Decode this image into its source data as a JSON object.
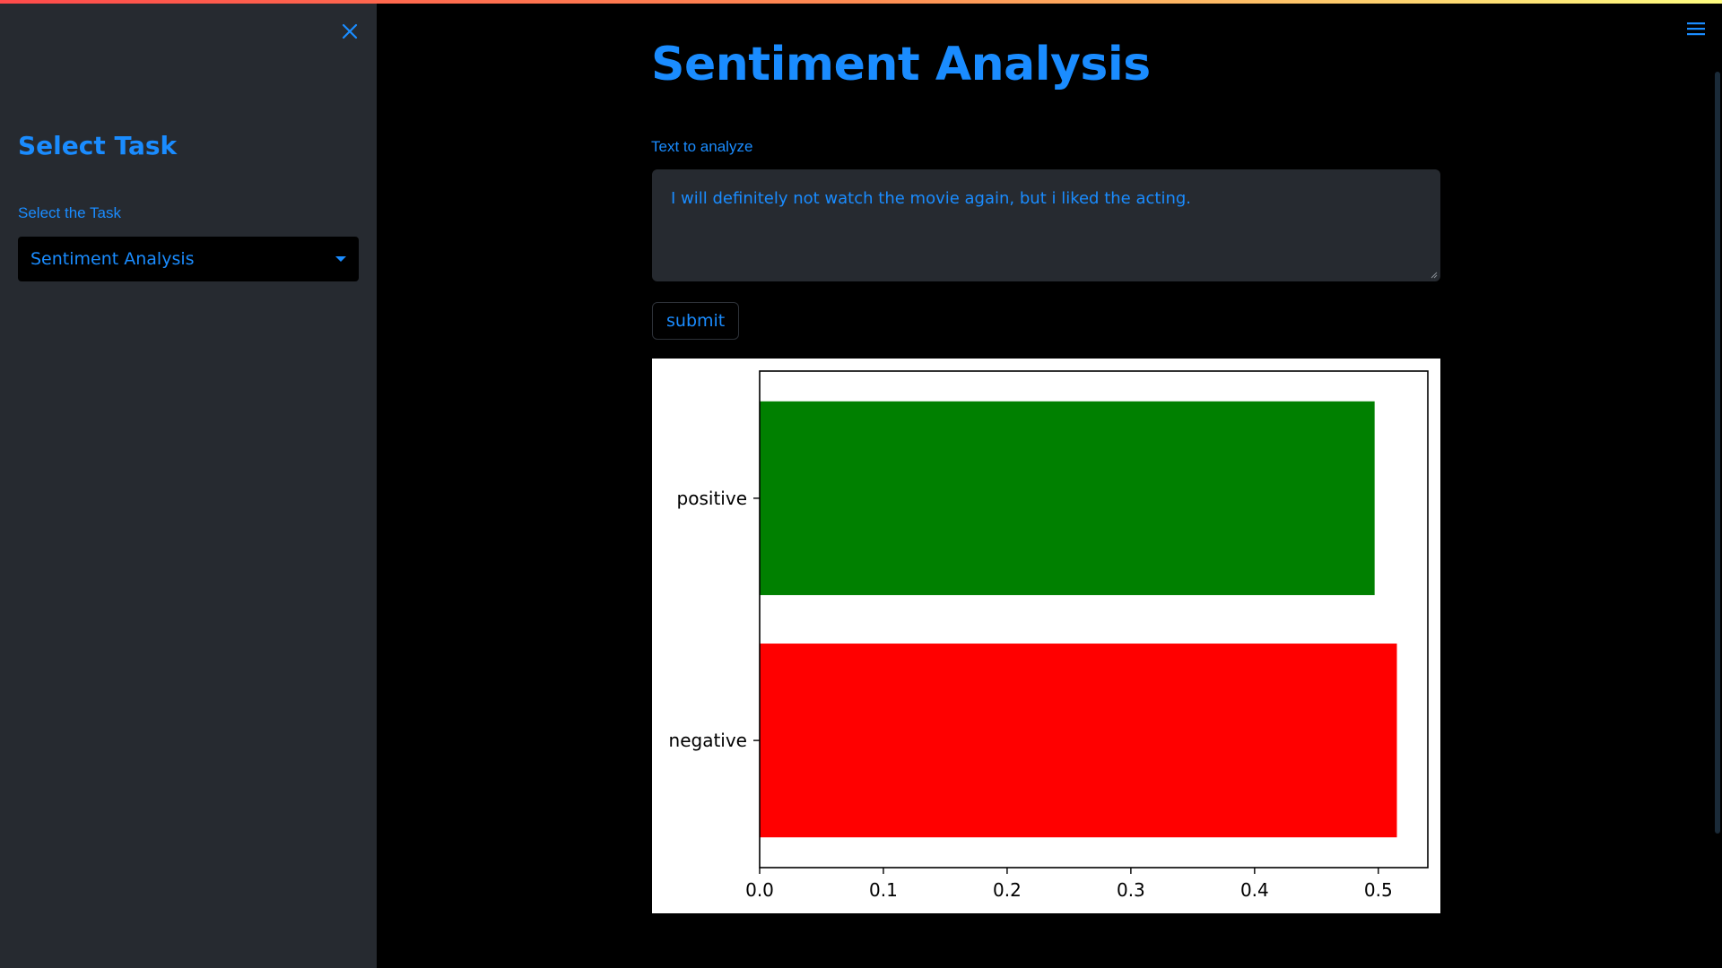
{
  "sidebar": {
    "heading": "Select Task",
    "task_label": "Select the Task",
    "task_value": "Sentiment Analysis",
    "close_icon": "close-icon"
  },
  "header": {
    "menu_icon": "hamburger-menu-icon"
  },
  "main": {
    "title": "Sentiment Analysis",
    "input_label": "Text to analyze",
    "input_value": "I will definitely not watch the movie again, but i liked the acting.",
    "submit_label": "submit"
  },
  "colors": {
    "accent": "#1a8cff",
    "sidebar_bg": "#262a30",
    "positive_bar": "#008000",
    "negative_bar": "#ff0000"
  },
  "chart_data": {
    "type": "bar",
    "orientation": "horizontal",
    "categories": [
      "negative",
      "positive"
    ],
    "values": [
      0.515,
      0.497
    ],
    "bar_colors": [
      "#ff0000",
      "#008000"
    ],
    "xlim": [
      0,
      0.54
    ],
    "xticks": [
      "0.0",
      "0.1",
      "0.2",
      "0.3",
      "0.4",
      "0.5"
    ],
    "title": "",
    "xlabel": "",
    "ylabel": "",
    "grid": false
  }
}
